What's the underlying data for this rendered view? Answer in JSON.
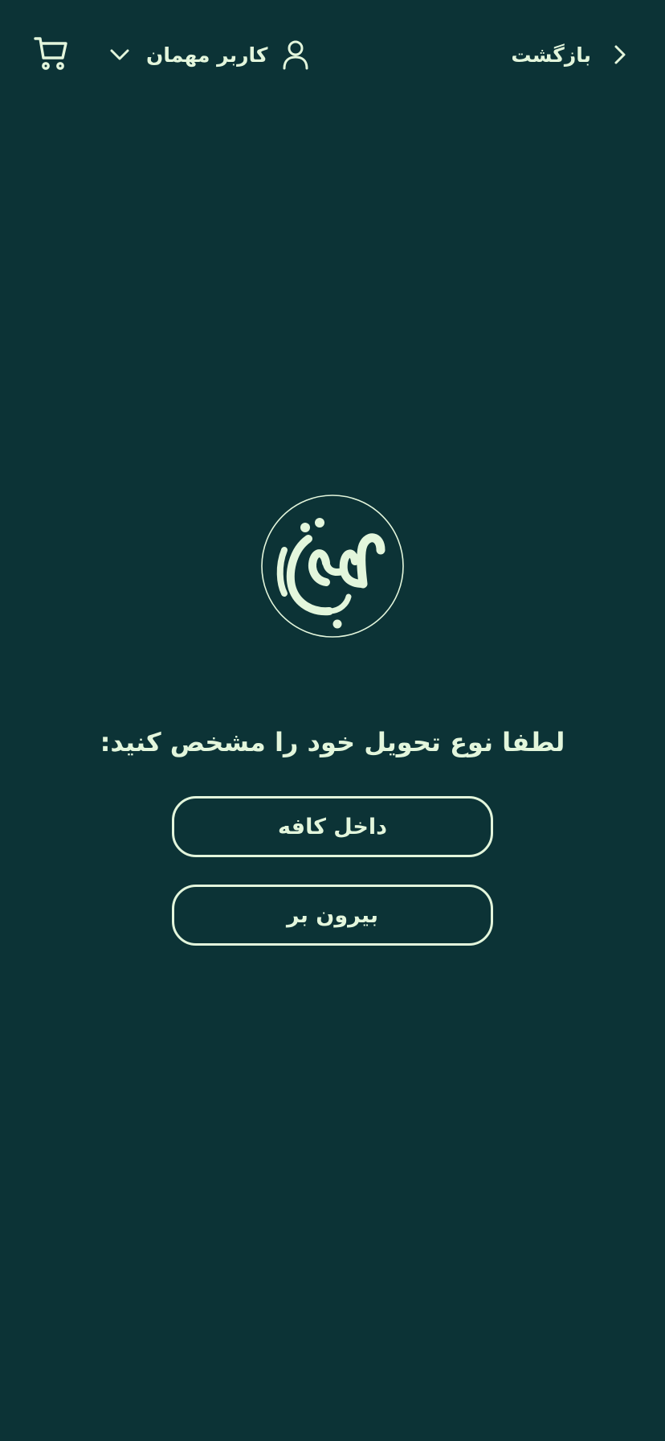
{
  "header": {
    "back_label": "بازگشت",
    "user_label": "کاربر مهمان",
    "icons": {
      "cart": "cart-icon",
      "user_dropdown": "chevron-down-icon",
      "user": "user-icon",
      "back": "chevron-right-icon"
    }
  },
  "main": {
    "logo_icon": "brand-logo",
    "prompt": "لطفا نوع تحویل خود را مشخص کنید:",
    "options": [
      {
        "label": "داخل کافه"
      },
      {
        "label": "بیرون بر"
      }
    ]
  },
  "colors": {
    "background": "#0c3336",
    "foreground": "#e3f6dc"
  }
}
